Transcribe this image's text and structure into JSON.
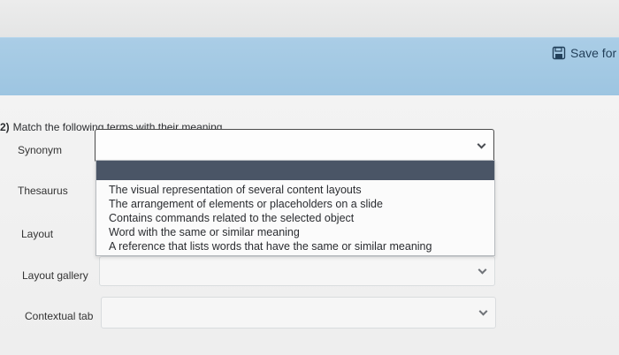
{
  "header": {
    "save_label": "Save for"
  },
  "question": {
    "number": "2)",
    "prompt": "Match the following terms with their meaning."
  },
  "terms": [
    {
      "label": "Synonym",
      "selected": ""
    },
    {
      "label": "Thesaurus",
      "selected": ""
    },
    {
      "label": "Layout",
      "selected": ""
    },
    {
      "label": "Layout gallery",
      "selected": ""
    },
    {
      "label": "Contextual tab",
      "selected": ""
    }
  ],
  "dropdown": {
    "highlighted_option": "",
    "options": [
      "The visual representation of several content layouts",
      "The arrangement of elements or placeholders on a slide",
      "Contains commands related to the selected object",
      "Word with the same or similar meaning",
      "A reference that lists words that have the same or similar meaning"
    ]
  },
  "icons": {
    "save": "save-disk-icon",
    "chevron": "chevron-down-icon"
  },
  "colors": {
    "banner": "#a6cbe5",
    "highlight": "#4a5566"
  }
}
